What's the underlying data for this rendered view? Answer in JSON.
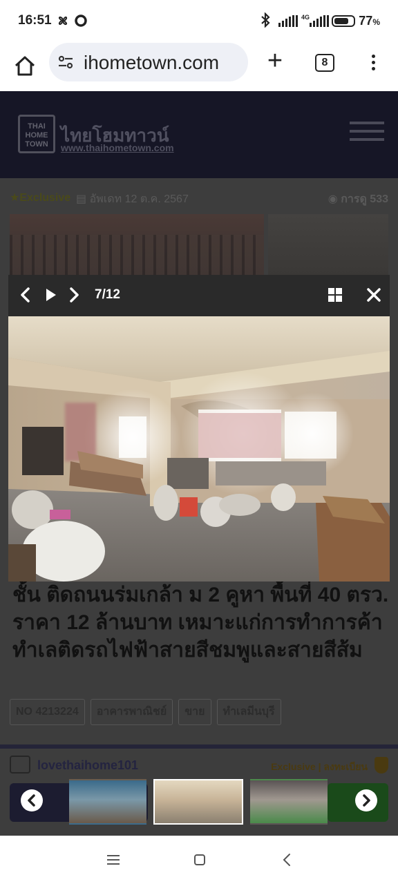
{
  "status_bar": {
    "time": "16:51",
    "network_type": "4G",
    "battery_percent": "77",
    "battery_suffix": "%",
    "battery_level": 0.77
  },
  "browser": {
    "url": "ihometown.com",
    "tab_count": "8"
  },
  "site": {
    "logo_mark_line1": "THAI",
    "logo_mark_line2": "HOME",
    "logo_mark_line3": "TOWN",
    "logo_name": "ไทยโฮมทาวน์",
    "logo_url": "www.thaihometown.com"
  },
  "listing": {
    "exclusive_label": "Exclusive",
    "updated_label": "อัพเดท 12 ต.ค. 2567",
    "views_label": "การดู 533",
    "title": "ชั้น ติดถนนร่มเกล้า ม 2 คูหา พื้นที่ 40 ตรว. ราคา 12 ล้านบาท เหมาะแก่การทำการค้า ทำเลติดรถไฟฟ้าสายสีชมพูและสายสีส้ม",
    "tags": [
      "NO 4213224",
      "อาคารพาณิชย์",
      "ขาย",
      "ทำเลมีนบุรี"
    ],
    "agent_name": "lovethaihome101",
    "agent_badge": "Exclusive | ลงทะเบียน"
  },
  "lightbox": {
    "counter": "7/12",
    "current": 7,
    "total": 12
  },
  "colors": {
    "header_bg": "#161626",
    "overlay_bg": "#3d3d3d",
    "toolbar_bg": "#2a2a2a"
  },
  "icons": [
    "home-icon",
    "site-settings-icon",
    "new-tab-icon",
    "tab-switcher-icon",
    "menu-dots-icon",
    "prev-icon",
    "play-icon",
    "next-icon",
    "grid-icon",
    "close-icon"
  ]
}
